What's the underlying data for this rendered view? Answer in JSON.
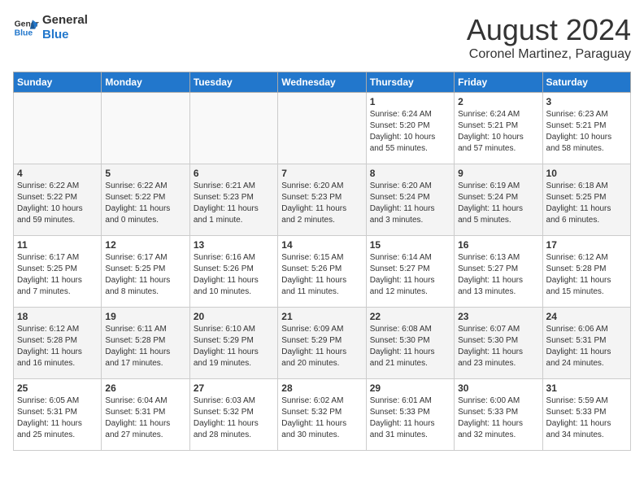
{
  "header": {
    "logo_line1": "General",
    "logo_line2": "Blue",
    "month_year": "August 2024",
    "location": "Coronel Martinez, Paraguay"
  },
  "weekdays": [
    "Sunday",
    "Monday",
    "Tuesday",
    "Wednesday",
    "Thursday",
    "Friday",
    "Saturday"
  ],
  "weeks": [
    [
      {
        "day": "",
        "info": ""
      },
      {
        "day": "",
        "info": ""
      },
      {
        "day": "",
        "info": ""
      },
      {
        "day": "",
        "info": ""
      },
      {
        "day": "1",
        "info": "Sunrise: 6:24 AM\nSunset: 5:20 PM\nDaylight: 10 hours\nand 55 minutes."
      },
      {
        "day": "2",
        "info": "Sunrise: 6:24 AM\nSunset: 5:21 PM\nDaylight: 10 hours\nand 57 minutes."
      },
      {
        "day": "3",
        "info": "Sunrise: 6:23 AM\nSunset: 5:21 PM\nDaylight: 10 hours\nand 58 minutes."
      }
    ],
    [
      {
        "day": "4",
        "info": "Sunrise: 6:22 AM\nSunset: 5:22 PM\nDaylight: 10 hours\nand 59 minutes."
      },
      {
        "day": "5",
        "info": "Sunrise: 6:22 AM\nSunset: 5:22 PM\nDaylight: 11 hours\nand 0 minutes."
      },
      {
        "day": "6",
        "info": "Sunrise: 6:21 AM\nSunset: 5:23 PM\nDaylight: 11 hours\nand 1 minute."
      },
      {
        "day": "7",
        "info": "Sunrise: 6:20 AM\nSunset: 5:23 PM\nDaylight: 11 hours\nand 2 minutes."
      },
      {
        "day": "8",
        "info": "Sunrise: 6:20 AM\nSunset: 5:24 PM\nDaylight: 11 hours\nand 3 minutes."
      },
      {
        "day": "9",
        "info": "Sunrise: 6:19 AM\nSunset: 5:24 PM\nDaylight: 11 hours\nand 5 minutes."
      },
      {
        "day": "10",
        "info": "Sunrise: 6:18 AM\nSunset: 5:25 PM\nDaylight: 11 hours\nand 6 minutes."
      }
    ],
    [
      {
        "day": "11",
        "info": "Sunrise: 6:17 AM\nSunset: 5:25 PM\nDaylight: 11 hours\nand 7 minutes."
      },
      {
        "day": "12",
        "info": "Sunrise: 6:17 AM\nSunset: 5:25 PM\nDaylight: 11 hours\nand 8 minutes."
      },
      {
        "day": "13",
        "info": "Sunrise: 6:16 AM\nSunset: 5:26 PM\nDaylight: 11 hours\nand 10 minutes."
      },
      {
        "day": "14",
        "info": "Sunrise: 6:15 AM\nSunset: 5:26 PM\nDaylight: 11 hours\nand 11 minutes."
      },
      {
        "day": "15",
        "info": "Sunrise: 6:14 AM\nSunset: 5:27 PM\nDaylight: 11 hours\nand 12 minutes."
      },
      {
        "day": "16",
        "info": "Sunrise: 6:13 AM\nSunset: 5:27 PM\nDaylight: 11 hours\nand 13 minutes."
      },
      {
        "day": "17",
        "info": "Sunrise: 6:12 AM\nSunset: 5:28 PM\nDaylight: 11 hours\nand 15 minutes."
      }
    ],
    [
      {
        "day": "18",
        "info": "Sunrise: 6:12 AM\nSunset: 5:28 PM\nDaylight: 11 hours\nand 16 minutes."
      },
      {
        "day": "19",
        "info": "Sunrise: 6:11 AM\nSunset: 5:28 PM\nDaylight: 11 hours\nand 17 minutes."
      },
      {
        "day": "20",
        "info": "Sunrise: 6:10 AM\nSunset: 5:29 PM\nDaylight: 11 hours\nand 19 minutes."
      },
      {
        "day": "21",
        "info": "Sunrise: 6:09 AM\nSunset: 5:29 PM\nDaylight: 11 hours\nand 20 minutes."
      },
      {
        "day": "22",
        "info": "Sunrise: 6:08 AM\nSunset: 5:30 PM\nDaylight: 11 hours\nand 21 minutes."
      },
      {
        "day": "23",
        "info": "Sunrise: 6:07 AM\nSunset: 5:30 PM\nDaylight: 11 hours\nand 23 minutes."
      },
      {
        "day": "24",
        "info": "Sunrise: 6:06 AM\nSunset: 5:31 PM\nDaylight: 11 hours\nand 24 minutes."
      }
    ],
    [
      {
        "day": "25",
        "info": "Sunrise: 6:05 AM\nSunset: 5:31 PM\nDaylight: 11 hours\nand 25 minutes."
      },
      {
        "day": "26",
        "info": "Sunrise: 6:04 AM\nSunset: 5:31 PM\nDaylight: 11 hours\nand 27 minutes."
      },
      {
        "day": "27",
        "info": "Sunrise: 6:03 AM\nSunset: 5:32 PM\nDaylight: 11 hours\nand 28 minutes."
      },
      {
        "day": "28",
        "info": "Sunrise: 6:02 AM\nSunset: 5:32 PM\nDaylight: 11 hours\nand 30 minutes."
      },
      {
        "day": "29",
        "info": "Sunrise: 6:01 AM\nSunset: 5:33 PM\nDaylight: 11 hours\nand 31 minutes."
      },
      {
        "day": "30",
        "info": "Sunrise: 6:00 AM\nSunset: 5:33 PM\nDaylight: 11 hours\nand 32 minutes."
      },
      {
        "day": "31",
        "info": "Sunrise: 5:59 AM\nSunset: 5:33 PM\nDaylight: 11 hours\nand 34 minutes."
      }
    ]
  ]
}
